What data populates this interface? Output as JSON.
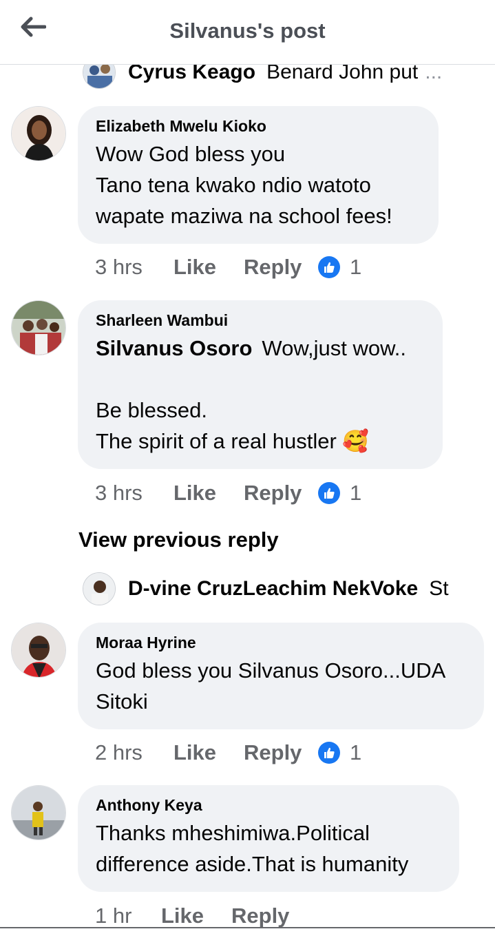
{
  "header": {
    "title": "Silvanus's post"
  },
  "preview_reply_1": {
    "name": "Cyrus Keago",
    "text": "Benard John put",
    "ellipsis": "..."
  },
  "comments": [
    {
      "author": "Elizabeth Mwelu Kioko",
      "lines": [
        "Wow God bless you",
        "Tano tena kwako ndio watoto",
        "wapate maziwa na school fees!"
      ],
      "time": "3 hrs",
      "like": "Like",
      "reply": "Reply",
      "reactions": "1"
    },
    {
      "author": "Sharleen Wambui",
      "tag": "Silvanus Osoro",
      "lines": [
        "Wow,just wow..",
        "",
        "Be blessed.",
        "The spirit of a real hustler"
      ],
      "emoji": "🥰",
      "time": "3 hrs",
      "like": "Like",
      "reply": "Reply",
      "reactions": "1"
    },
    {
      "author": "Moraa Hyrine",
      "lines": [
        "God bless you Silvanus Osoro...UDA",
        "Sitoki"
      ],
      "time": "2 hrs",
      "like": "Like",
      "reply": "Reply",
      "reactions": "1"
    },
    {
      "author": "Anthony Keya",
      "lines": [
        "Thanks mheshimiwa.Political",
        "difference aside.That is humanity"
      ],
      "time": "1 hr",
      "like": "Like",
      "reply": "Reply"
    }
  ],
  "view_previous": "View previous reply",
  "preview_reply_2": {
    "name": "D-vine CruzLeachim NekVoke",
    "text": "St"
  },
  "colors": {
    "accent": "#1877f2",
    "bubble": "#f0f2f5",
    "muted": "#65676b"
  }
}
